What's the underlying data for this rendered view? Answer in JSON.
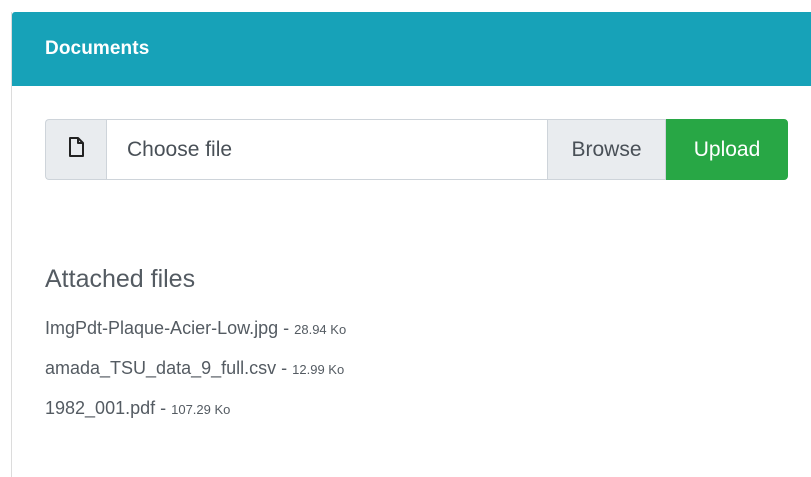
{
  "card": {
    "title": "Documents"
  },
  "upload": {
    "file_icon": "file-icon",
    "placeholder": "Choose file",
    "browse_label": "Browse",
    "upload_label": "Upload"
  },
  "attached": {
    "title": "Attached files",
    "separator": " - ",
    "files": [
      {
        "name": "ImgPdt-Plaque-Acier-Low.jpg",
        "size": "28.94 Ko"
      },
      {
        "name": "amada_TSU_data_9_full.csv",
        "size": "12.99 Ko"
      },
      {
        "name": "1982_001.pdf",
        "size": "107.29 Ko"
      }
    ]
  },
  "colors": {
    "header": "#17a2b8",
    "upload_button": "#28a745",
    "addon_bg": "#e9ecef"
  }
}
